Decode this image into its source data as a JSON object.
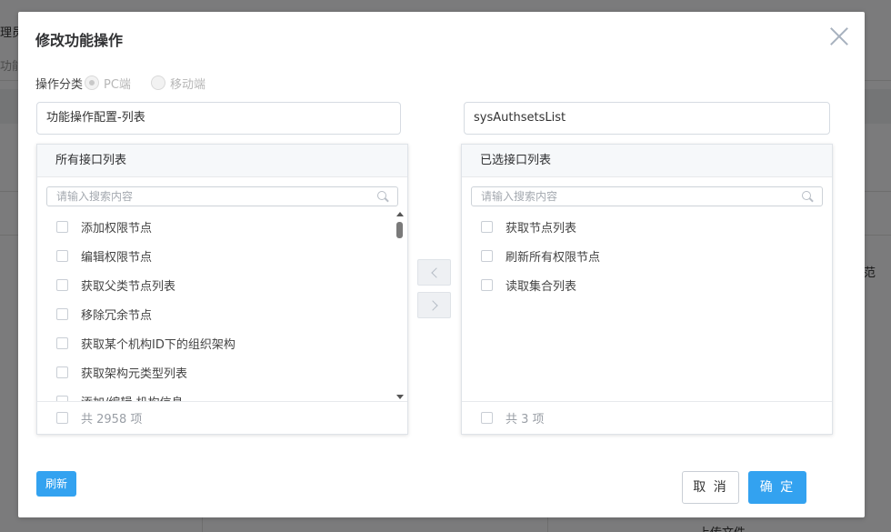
{
  "background": {
    "fragment_1": "理员",
    "fragment_2": "功能",
    "fragment_3": "范",
    "fragment_4": "上传文件"
  },
  "dialog": {
    "title": "修改功能操作",
    "category_label": "操作分类",
    "radio_options": [
      {
        "label": "PC端",
        "selected": true
      },
      {
        "label": "移动端",
        "selected": false
      }
    ],
    "name_input_value": "功能操作配置-列表",
    "code_input_value": "sysAuthsetsList",
    "left_panel": {
      "header": "所有接口列表",
      "search_placeholder": "请输入搜索内容",
      "items": [
        "添加权限节点",
        "编辑权限节点",
        "获取父类节点列表",
        "移除冗余节点",
        "获取某个机构ID下的组织架构",
        "获取架构元类型列表",
        "添加/编辑 机构信息"
      ],
      "footer": "共 2958 项"
    },
    "right_panel": {
      "header": "已选接口列表",
      "search_placeholder": "请输入搜索内容",
      "items": [
        "获取节点列表",
        "刷新所有权限节点",
        "读取集合列表"
      ],
      "footer": "共 3 项"
    },
    "refresh_label": "刷新",
    "cancel_label": "取 消",
    "ok_label": "确 定"
  },
  "colors": {
    "primary": "#33a2f0",
    "overlay": "rgba(0,0,0,0.5)"
  }
}
